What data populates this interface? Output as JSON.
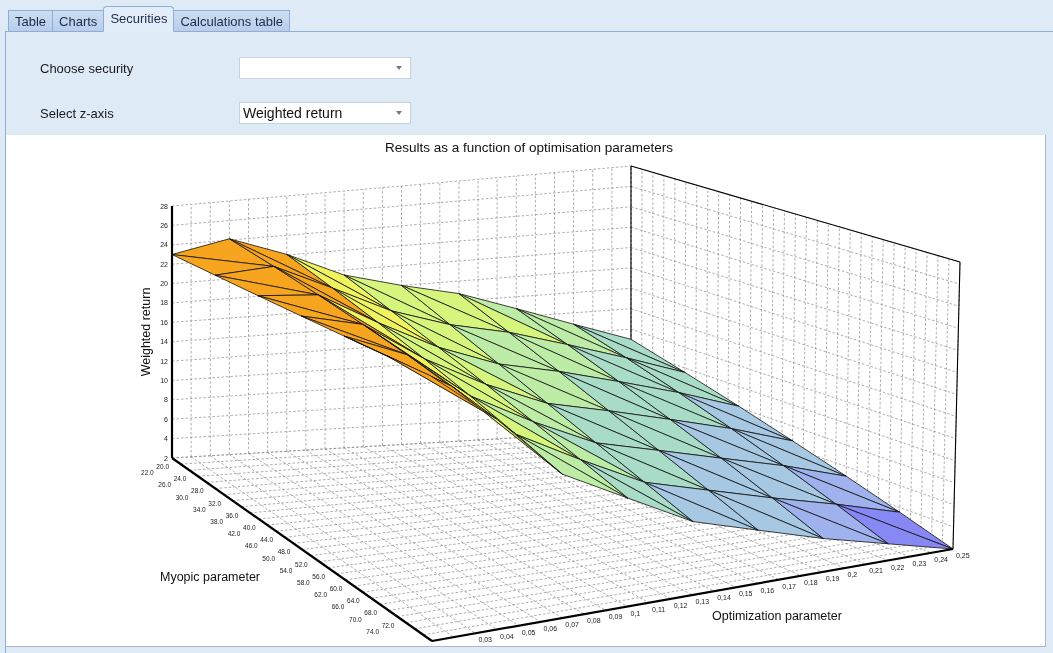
{
  "tabs": [
    {
      "label": "Table",
      "selected": false
    },
    {
      "label": "Charts",
      "selected": false
    },
    {
      "label": "Securities",
      "selected": true
    },
    {
      "label": "Calculations table",
      "selected": false
    }
  ],
  "form": {
    "fields": [
      {
        "label": "Choose security"
      },
      {
        "label": "Select z-axis",
        "value": "Weighted return"
      }
    ]
  },
  "chart": {
    "title": "Results as a function of optimisation parameters",
    "z_axis": {
      "title": "Weighted return",
      "ticks": [
        "28",
        "26",
        "24",
        "22",
        "20",
        "18",
        "16",
        "14",
        "12",
        "10",
        "8",
        "6",
        "4",
        "2"
      ]
    },
    "myopic_axis": {
      "title": "Myopic parameter",
      "ticks": [
        "20.0",
        "22.0",
        "24.0",
        "26.0",
        "28.0",
        "30.0",
        "32.0",
        "34.0",
        "36.0",
        "38.0",
        "40.0",
        "42.0",
        "44.0",
        "46.0",
        "48.0",
        "50.0",
        "52.0",
        "54.0",
        "56.0",
        "58.0",
        "60.0",
        "62.0",
        "64.0",
        "66.0",
        "68.0",
        "70.0",
        "72.0",
        "74.0"
      ]
    },
    "optimization_axis": {
      "title": "Optimization parameter",
      "ticks": [
        "0,03",
        "0,04",
        "0,05",
        "0,06",
        "0,07",
        "0,08",
        "0,09",
        "0,1",
        "0,11",
        "0,12",
        "0,13",
        "0,14",
        "0,15",
        "0,16",
        "0,17",
        "0,18",
        "0,19",
        "0,2",
        "0,21",
        "0,22",
        "0,23",
        "0,24",
        "0,25"
      ]
    }
  }
}
